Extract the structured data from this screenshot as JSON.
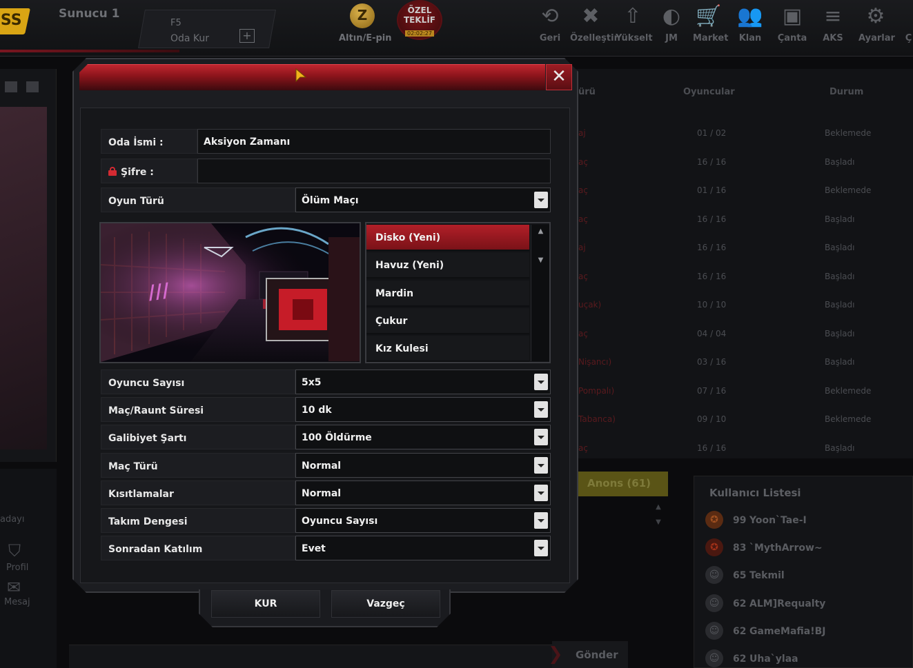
{
  "topbar": {
    "logo_text": "SS",
    "server_name": "Sunucu 1",
    "room_tab": {
      "key": "F5",
      "label": "Oda Kur",
      "plus": "+"
    },
    "gold": {
      "symbol": "Z",
      "label": "Altın/E-pin"
    },
    "special_offer": {
      "line1": "ÖZEL",
      "line2": "TEKLİF",
      "timer": "02:02:27"
    },
    "nav": [
      {
        "label": "Geri",
        "icon": "back-icon",
        "glyph": "⟲"
      },
      {
        "label": "Özelleştir",
        "icon": "tools-icon",
        "glyph": "✖"
      },
      {
        "label": "Yükselt",
        "icon": "upgrade-icon",
        "glyph": "⇧"
      },
      {
        "label": "JM",
        "icon": "jm-icon",
        "glyph": "◐"
      },
      {
        "label": "Market",
        "icon": "cart-icon",
        "glyph": "🛒"
      },
      {
        "label": "Klan",
        "icon": "clan-icon",
        "glyph": "👥"
      },
      {
        "label": "Çanta",
        "icon": "bag-icon",
        "glyph": "▣"
      },
      {
        "label": "AKS",
        "icon": "aks-icon",
        "glyph": "≡"
      },
      {
        "label": "Ayarlar",
        "icon": "gear-icon",
        "glyph": "⚙"
      },
      {
        "label": "Ç",
        "icon": "exit-icon",
        "glyph": ""
      }
    ]
  },
  "left_panel": {
    "text_1": "adayı",
    "profile_label": "Profil",
    "message_label": "Mesaj"
  },
  "room_list": {
    "headers": {
      "type": "ürü",
      "players": "Oyuncular",
      "status": "Durum"
    },
    "rows": [
      {
        "name": "aj",
        "players": "01 / 02",
        "status": "Beklemede"
      },
      {
        "name": "aç",
        "players": "16 / 16",
        "status": "Başladı"
      },
      {
        "name": "aç",
        "players": "01 / 16",
        "status": "Beklemede"
      },
      {
        "name": "aç",
        "players": "16 / 16",
        "status": "Başladı"
      },
      {
        "name": "aj",
        "players": "16 / 16",
        "status": "Başladı"
      },
      {
        "name": "aç",
        "players": "16 / 16",
        "status": "Başladı"
      },
      {
        "name": "uçak)",
        "players": "10 / 10",
        "status": "Başladı"
      },
      {
        "name": "aç",
        "players": "04 / 04",
        "status": "Başladı"
      },
      {
        "name": "Nişancı)",
        "players": "03 / 16",
        "status": "Başladı"
      },
      {
        "name": "Pompalı)",
        "players": "07 / 16",
        "status": "Beklemede"
      },
      {
        "name": "Tabanca)",
        "players": "09 / 10",
        "status": "Beklemede"
      },
      {
        "name": "aç",
        "players": "16 / 16",
        "status": "Başladı"
      }
    ]
  },
  "anons_tab": "Anons (61)",
  "send_button": "Gönder",
  "user_list": {
    "title": "Kullanıcı Listesi",
    "users": [
      {
        "level": "99",
        "name": "Yoon`Tae-I"
      },
      {
        "level": "83",
        "name": "`MythArrow~"
      },
      {
        "level": "65",
        "name": "Tekmil"
      },
      {
        "level": "62",
        "name": "ALM]Requalty"
      },
      {
        "level": "62",
        "name": "GameMafia!BJ"
      },
      {
        "level": "62",
        "name": "Uha`ylaa"
      }
    ]
  },
  "dialog": {
    "close": "✕",
    "room_name": {
      "label": "Oda İsmi :",
      "value": "Aksiyon Zamanı"
    },
    "password": {
      "label": "Şifre :",
      "value": ""
    },
    "game_type": {
      "label": "Oyun Türü",
      "value": "Ölüm Maçı"
    },
    "maps": [
      "Disko (Yeni)",
      "Havuz (Yeni)",
      "Mardin",
      "Çukur",
      "Kız Kulesi"
    ],
    "selected_map": "Disko (Yeni)",
    "settings": [
      {
        "label": "Oyuncu Sayısı",
        "value": "5x5"
      },
      {
        "label": "Maç/Raunt Süresi",
        "value": "10 dk"
      },
      {
        "label": "Galibiyet Şartı",
        "value": "100 Öldürme"
      },
      {
        "label": "Maç Türü",
        "value": "Normal"
      },
      {
        "label": "Kısıtlamalar",
        "value": "Normal"
      },
      {
        "label": "Takım Dengesi",
        "value": "Oyuncu Sayısı"
      },
      {
        "label": "Sonradan Katılım",
        "value": "Evet"
      }
    ],
    "create_button": "KUR",
    "cancel_button": "Vazgeç"
  }
}
